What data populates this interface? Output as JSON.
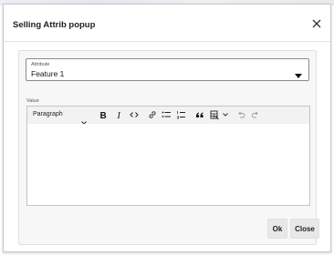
{
  "dialog": {
    "title": "Selling Attrib popup",
    "close_icon": "close-icon"
  },
  "attribute_field": {
    "label": "Attribute",
    "value": "Feature 1",
    "caret_icon": "caret-down-icon"
  },
  "value_field": {
    "label": "Value",
    "content": ""
  },
  "toolbar": {
    "paragraph_select": "Paragraph",
    "buttons": [
      "bold-icon",
      "italic-icon",
      "code-icon",
      "link-icon",
      "bulleted-list-icon",
      "numbered-list-icon",
      "blockquote-icon",
      "insert-table-icon",
      "undo-icon",
      "redo-icon"
    ]
  },
  "actions": {
    "ok_label": "Ok",
    "close_label": "Close"
  }
}
